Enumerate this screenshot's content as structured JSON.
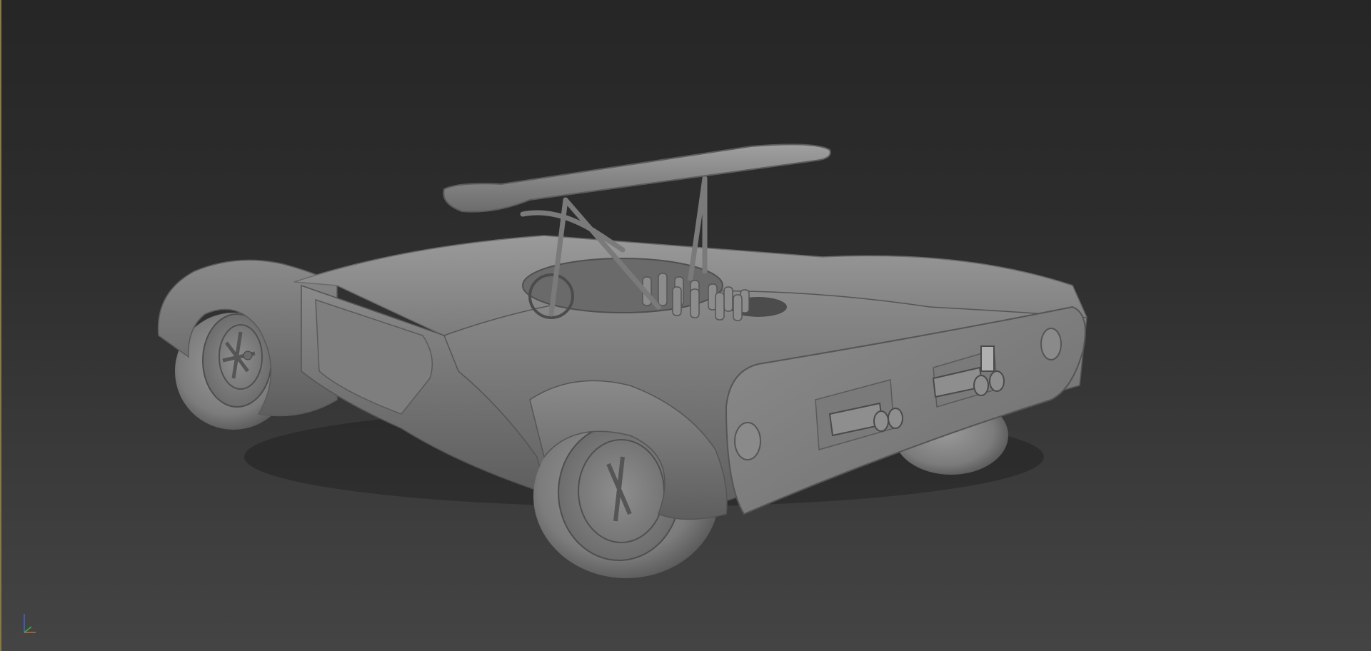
{
  "viewport": {
    "shading": "clay",
    "background_top": "#262626",
    "background_bottom": "#444444",
    "active_border_color": "#8a7a3a"
  },
  "model": {
    "subject": "race-car-clay-render"
  },
  "gizmo": {
    "x_color": "#c86432",
    "y_color": "#3cb43c",
    "z_color": "#3c64d2"
  }
}
